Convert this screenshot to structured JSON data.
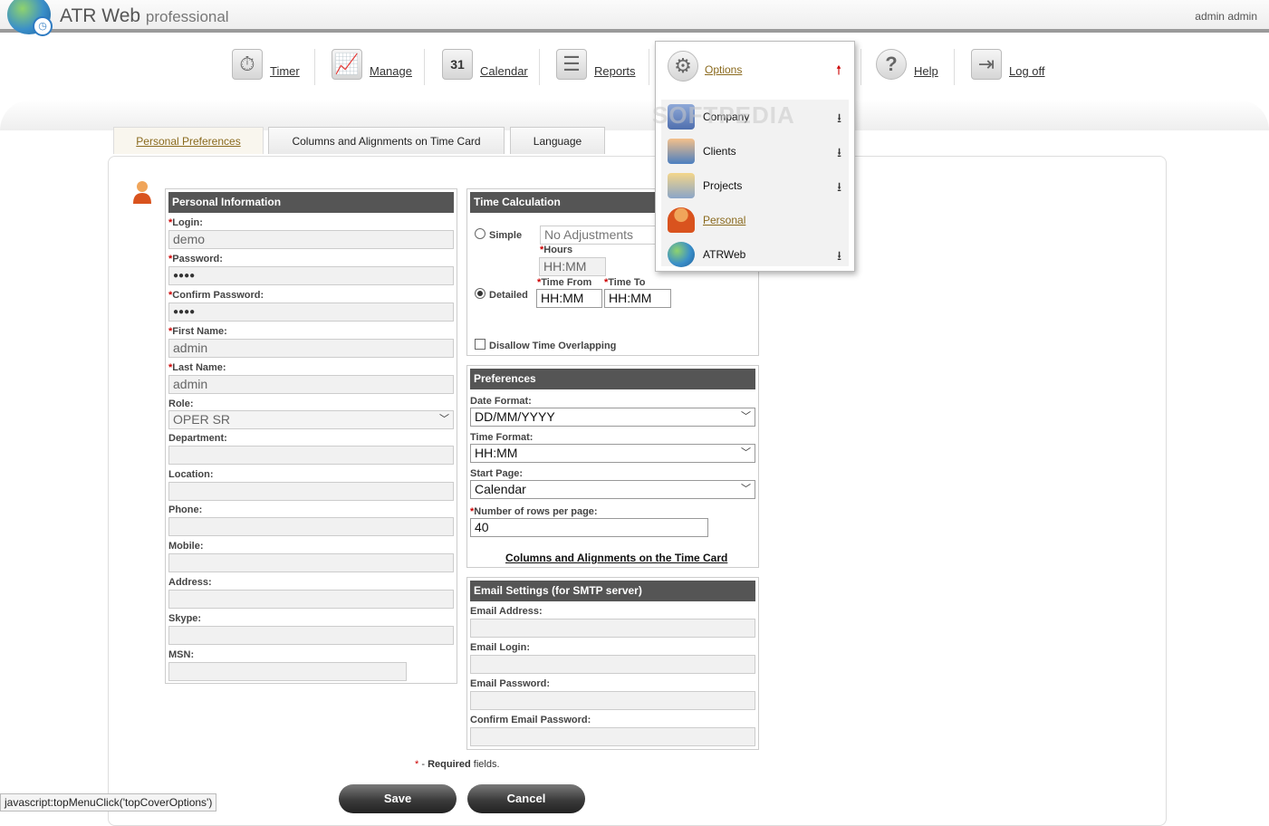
{
  "header": {
    "brand": "ATR Web",
    "brand_sub": "professional",
    "user": "admin admin"
  },
  "nav": [
    {
      "label": "Timer",
      "icon": "stopwatch-icon"
    },
    {
      "label": "Manage",
      "icon": "chart-icon"
    },
    {
      "label": "Calendar",
      "icon": "calendar-icon",
      "glyph": "31"
    },
    {
      "label": "Reports",
      "icon": "report-icon"
    },
    {
      "label": "Options",
      "icon": "gear-icon"
    },
    {
      "label": "Help",
      "icon": "help-icon",
      "glyph": "?"
    },
    {
      "label": "Log off",
      "icon": "logoff-icon"
    }
  ],
  "options_menu": {
    "title": "Options",
    "items": [
      {
        "label": "Company",
        "icon": "building-icon",
        "arrow": "⭳"
      },
      {
        "label": "Clients",
        "icon": "people-icon",
        "arrow": "⭳"
      },
      {
        "label": "Projects",
        "icon": "folder-gear-icon",
        "arrow": "⭳"
      },
      {
        "label": "Personal",
        "icon": "person-icon"
      },
      {
        "label": "ATRWeb",
        "icon": "globe-icon",
        "arrow": "⭳"
      }
    ]
  },
  "tabs": [
    {
      "label": "Personal Preferences",
      "active": true
    },
    {
      "label": "Columns and Alignments on Time Card"
    },
    {
      "label": "Language"
    }
  ],
  "personal": {
    "title": "Personal Information",
    "login_label": "Login:",
    "login": "demo",
    "password_label": "Password:",
    "password": "●●●●",
    "confirm_label": "Confirm Password:",
    "confirm": "●●●●",
    "first_label": "First Name:",
    "first": "admin",
    "last_label": "Last Name:",
    "last": "admin",
    "role_label": "Role:",
    "role": "OPER SR",
    "department_label": "Department:",
    "location_label": "Location:",
    "phone_label": "Phone:",
    "mobile_label": "Mobile:",
    "address_label": "Address:",
    "skype_label": "Skype:",
    "msn_label": "MSN:"
  },
  "time_calc": {
    "title": "Time Calculation",
    "simple_label": "Simple",
    "simple_value": "No Adjustments",
    "hours_label": "Hours",
    "hours_ph": "HH:MM",
    "detailed_label": "Detailed",
    "from_label": "Time From",
    "to_label": "Time To",
    "from": "HH:MM",
    "to": "HH:MM",
    "overlap_label": "Disallow Time Overlapping"
  },
  "preferences": {
    "title": "Preferences",
    "date_label": "Date Format:",
    "date": "DD/MM/YYYY",
    "time_label": "Time Format:",
    "time": "HH:MM",
    "start_label": "Start Page:",
    "start": "Calendar",
    "rows_label": "Number of rows per page:",
    "rows": "40",
    "link": "Columns and Alignments on the Time Card"
  },
  "email": {
    "title": "Email Settings (for SMTP server)",
    "address_label": "Email Address:",
    "login_label": "Email Login:",
    "password_label": "Email Password:",
    "confirm_label": "Confirm Email Password:"
  },
  "required_note": {
    "star": "*",
    "dash": " - ",
    "bold": "Required",
    "rest": " fields."
  },
  "buttons": {
    "save": "Save",
    "cancel": "Cancel"
  },
  "status_bar": "javascript:topMenuClick('topCoverOptions')",
  "watermark": "SOFTPEDIA"
}
